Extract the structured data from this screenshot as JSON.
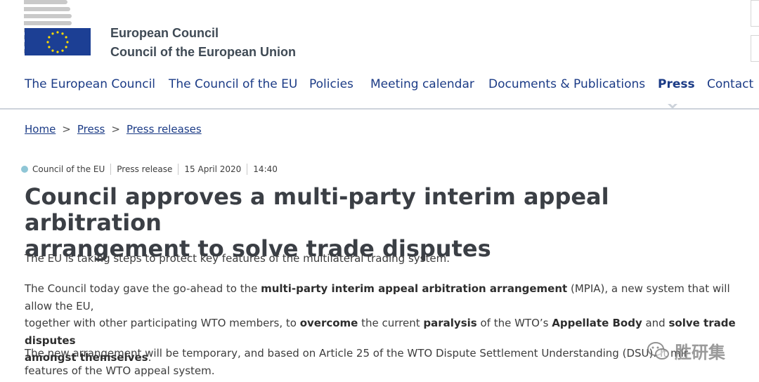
{
  "header": {
    "brand_line1": "European Council",
    "brand_line2": "Council of the European Union"
  },
  "nav": {
    "items": [
      {
        "label": "The European Council"
      },
      {
        "label": "The Council of the EU"
      },
      {
        "label": "Policies"
      },
      {
        "label": "Meeting calendar"
      },
      {
        "label": "Documents & Publications"
      },
      {
        "label": "Press",
        "active": true
      },
      {
        "label": "Contact"
      }
    ]
  },
  "breadcrumb": {
    "items": [
      "Home",
      "Press",
      "Press releases"
    ],
    "separator": ">"
  },
  "meta": {
    "source": "Council of the EU",
    "type": "Press release",
    "date": "15 April 2020",
    "time": "14:40"
  },
  "article": {
    "title_line1": "Council approves a multi-party interim appeal arbitration",
    "title_line2": "arrangement to solve trade disputes",
    "p1": "The EU is taking steps to protect key features of the multilateral trading system.",
    "p2": {
      "t1": "The Council today gave the go-ahead to the ",
      "b1": "multi-party interim appeal arbitration arrangement",
      "t2": " (MPIA), a new system that will allow the EU,",
      "t3": "together with other participating WTO members, to ",
      "b2": "overcome",
      "t4": " the current ",
      "b3": "paralysis",
      "t5": " of the WTO’s ",
      "b4": "Appellate Body",
      "t6": " and ",
      "b5": "solve trade disputes",
      "b6": "amongst themselves",
      "t7": "."
    },
    "p3": {
      "line1": "The new arrangement will be temporary, and based on Article 25 of the WTO Dispute Settlement Understanding (DSU). It mir",
      "line2": "features of the WTO appeal system."
    }
  },
  "watermark": {
    "text": "胜研集",
    "icon": "wechat-icon"
  },
  "colors": {
    "nav_link": "#1b3b86",
    "title": "#3b3f45",
    "body_text": "#3d3d3d",
    "flag_blue": "#1c3f94",
    "flag_star": "#ffdd00",
    "meta_dot": "#8fc6d6"
  }
}
